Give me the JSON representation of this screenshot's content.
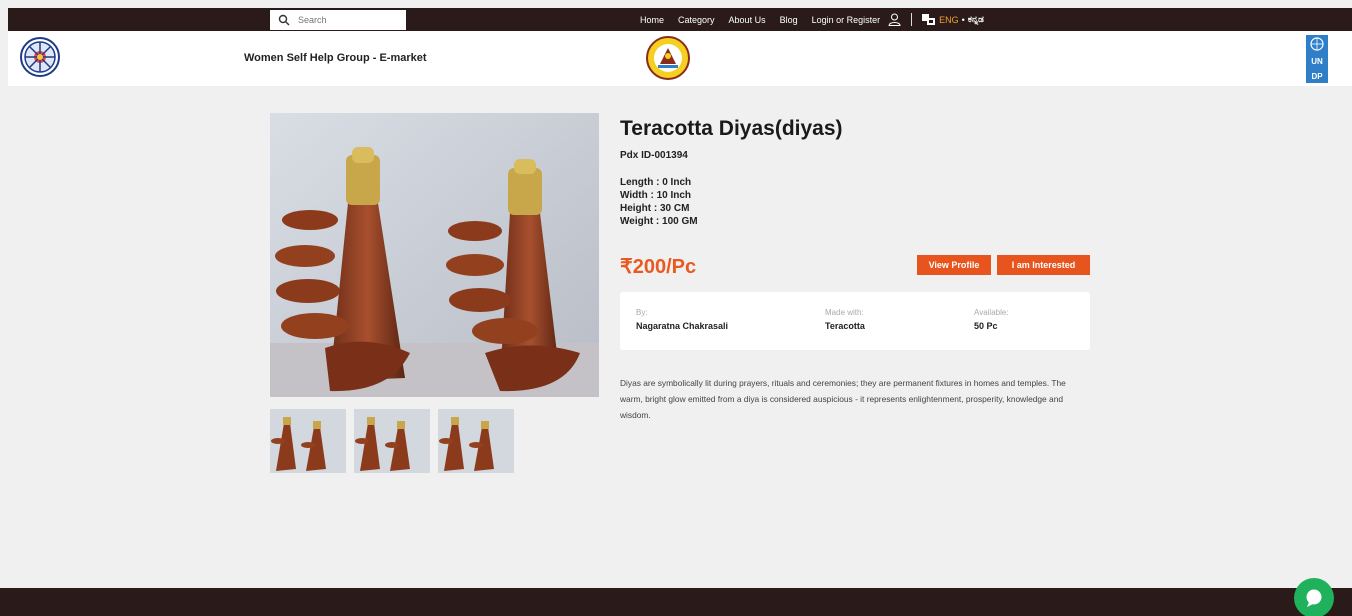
{
  "topbar": {
    "search_placeholder": "Search",
    "nav": [
      "Home",
      "Category",
      "About Us",
      "Blog",
      "Login or Register"
    ],
    "lang_en": "ENG",
    "lang_dot": "•",
    "lang_kn": "ಕನ್ನಡ"
  },
  "header": {
    "site_title": "Women Self Help Group - E-market",
    "undp_top": "UN",
    "undp_bottom": "DP"
  },
  "product": {
    "title": "Teracotta Diyas(diyas)",
    "id": "Pdx ID-001394",
    "length": "Length : 0 Inch",
    "width": "Width : 10 Inch",
    "height": "Height : 30 CM",
    "weight": "Weight : 100 GM",
    "price": "₹200/Pc",
    "view_profile": "View Profile",
    "interested": "I am Interested",
    "by_label": "By:",
    "by_value": "Nagaratna Chakrasali",
    "made_label": "Made with:",
    "made_value": "Teracotta",
    "avail_label": "Available:",
    "avail_value": "50 Pc",
    "description": "Diyas are symbolically lit during prayers, rituals and ceremonies; they are permanent fixtures in homes and temples. The warm, bright glow emitted from a diya is considered auspicious - it represents enlightenment, prosperity, knowledge and wisdom."
  },
  "colors": {
    "topbar_bg": "#2a1a1a",
    "accent": "#e8541e",
    "price": "#e85a22",
    "chat": "#1fb15c"
  }
}
